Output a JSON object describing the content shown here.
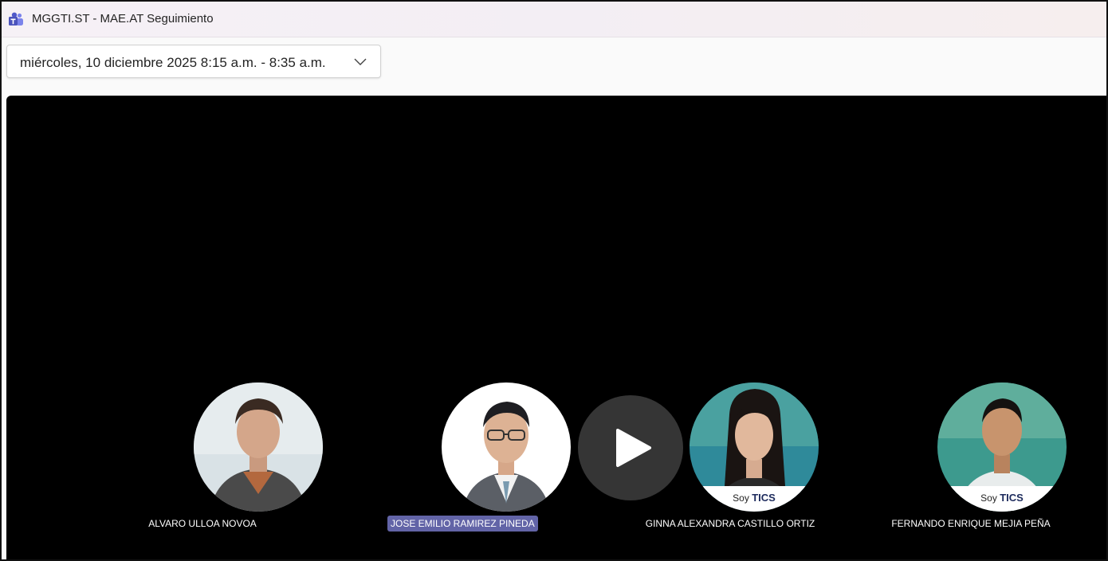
{
  "window": {
    "title": "MGGTI.ST - MAE.AT Seguimiento",
    "app_icon": "teams-icon"
  },
  "occurrence_selector": {
    "value": "miércoles, 10 diciembre 2025 8:15 a.m. - 8:35 a.m.",
    "icon": "chevron-down-icon"
  },
  "video": {
    "play_icon": "play-icon",
    "participants": [
      {
        "name": "ALVARO ULLOA NOVOA",
        "active": false
      },
      {
        "name": "JOSE EMILIO RAMIREZ PINEDA",
        "active": true
      },
      {
        "name": "GINNA ALEXANDRA CASTILLO ORTIZ",
        "active": false,
        "badge_prefix": "Soy",
        "badge_brand": "TICS"
      },
      {
        "name": "FERNANDO ENRIQUE MEJIA PEÑA",
        "active": false,
        "badge_prefix": "Soy",
        "badge_brand": "TICS"
      }
    ]
  },
  "colors": {
    "active_speaker": "#6264a7",
    "stage_background": "#000000"
  }
}
